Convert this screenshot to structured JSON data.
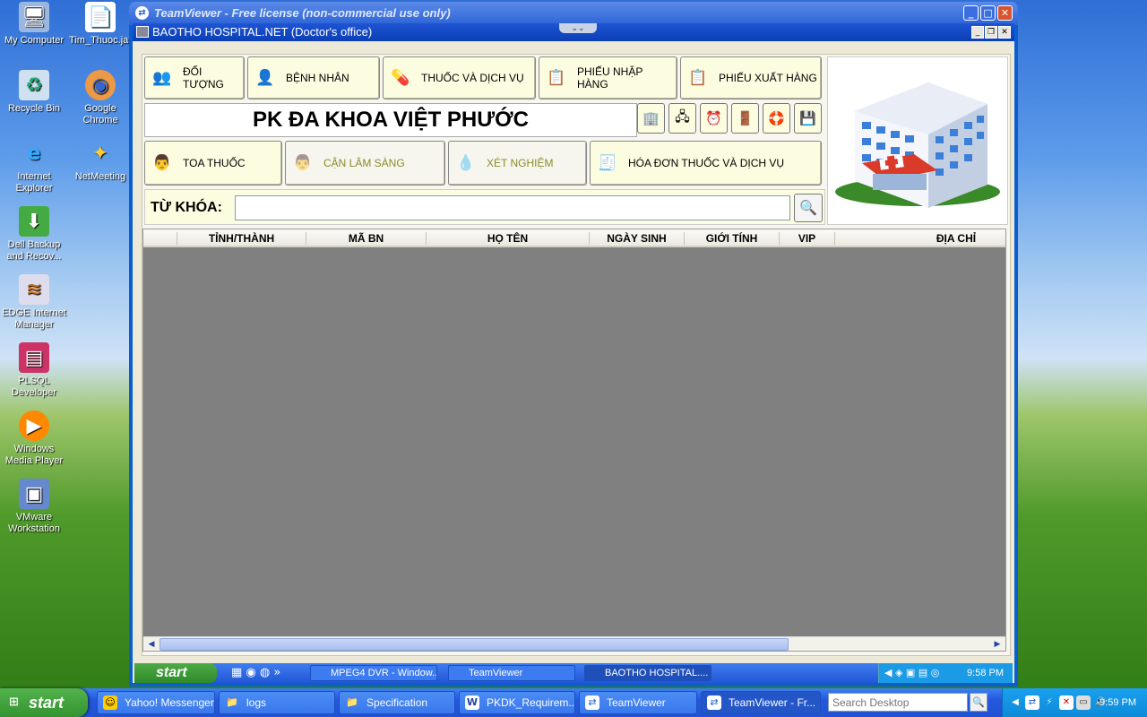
{
  "desktop": {
    "icons": [
      {
        "label": "My Computer",
        "name": "my-computer-icon",
        "glyph": "🖥"
      },
      {
        "label": "Tim_Thuoc.jar",
        "name": "jar-file-icon",
        "glyph": "📄"
      },
      {
        "label": "Recycle Bin",
        "name": "recycle-bin-icon",
        "glyph": "♻"
      },
      {
        "label": "Google Chrome",
        "name": "chrome-icon",
        "glyph": "◉"
      },
      {
        "label": "Internet Explorer",
        "name": "internet-explorer-icon",
        "glyph": "e"
      },
      {
        "label": "NetMeeting",
        "name": "netmeeting-icon",
        "glyph": "✦"
      },
      {
        "label": "Dell Backup and Recov...",
        "name": "dell-backup-icon",
        "glyph": "⬇"
      },
      {
        "label": "EDGE Internet Manager",
        "name": "edge-internet-manager-icon",
        "glyph": "≋"
      },
      {
        "label": "PLSQL Developer",
        "name": "plsql-developer-icon",
        "glyph": "▤"
      },
      {
        "label": "Windows Media Player",
        "name": "media-player-icon",
        "glyph": "▶"
      },
      {
        "label": "VMware Workstation",
        "name": "vmware-icon",
        "glyph": "▣"
      }
    ]
  },
  "teamviewer": {
    "title": "TeamViewer - Free license (non-commercial use only)",
    "icon": "⇄"
  },
  "inner_window": {
    "title": "BAOTHO HOSPITAL.NET (Doctor's office)",
    "grip": "⌄⌄"
  },
  "toolbar": {
    "top": [
      {
        "label": "ĐỐI TƯỢNG",
        "glyph": "👥",
        "name": "doi-tuong-button"
      },
      {
        "label": "BỆNH NHÂN",
        "glyph": "👤",
        "name": "benh-nhan-button"
      },
      {
        "label": "THUỐC VÀ DỊCH VỤ",
        "glyph": "💊",
        "name": "thuoc-dich-vu-button"
      },
      {
        "label": "PHIẾU NHẬP HÀNG",
        "glyph": "📋",
        "name": "phieu-nhap-hang-button"
      },
      {
        "label": "PHIẾU XUẤT HÀNG",
        "glyph": "📋",
        "name": "phieu-xuat-hang-button"
      }
    ],
    "bottom": [
      {
        "label": "TOA THUỐC",
        "glyph": "👨",
        "name": "toa-thuoc-button"
      },
      {
        "label": "CẬN LÂM SÀNG",
        "glyph": "👨",
        "name": "can-lam-sang-button"
      },
      {
        "label": "XÉT NGHIỆM",
        "glyph": "💧",
        "name": "xet-nghiem-button"
      },
      {
        "label": "HÓA ĐƠN THUỐC VÀ DỊCH VỤ",
        "glyph": "🧾",
        "name": "hoa-don-button"
      }
    ],
    "tools": [
      {
        "name": "hospital-tool-icon",
        "glyph": "🏢"
      },
      {
        "name": "network-tool-icon",
        "glyph": "🖧"
      },
      {
        "name": "clock-tool-icon",
        "glyph": "⏰"
      },
      {
        "name": "exit-tool-icon",
        "glyph": "🚪"
      },
      {
        "name": "help-lifebuoy-icon",
        "glyph": "🛟"
      },
      {
        "name": "save-disk-icon",
        "glyph": "💾"
      }
    ]
  },
  "clinic_name": "PK ĐA KHOA VIỆT PHƯỚC",
  "search": {
    "label": "TỪ KHÓA:",
    "value": "",
    "icon": "🔍"
  },
  "table": {
    "columns": [
      "TỈNH/THÀNH",
      "MÃ BN",
      "HỌ TÊN",
      "NGÀY SINH",
      "GIỚI TÍNH",
      "VIP",
      "ĐỊA CHỈ"
    ],
    "rows": []
  },
  "inner_taskbar": {
    "start": "start",
    "items": [
      "MPEG4 DVR - Window...",
      "TeamViewer",
      "BAOTHO HOSPITAL...."
    ],
    "time": "9:58 PM"
  },
  "taskbar": {
    "start": "start",
    "items": [
      {
        "label": "Yahoo! Messenger",
        "glyph": "☺"
      },
      {
        "label": "logs",
        "glyph": "📁"
      },
      {
        "label": "Specification",
        "glyph": "📁"
      },
      {
        "label": "PKDK_Requirem...",
        "glyph": "W"
      },
      {
        "label": "TeamViewer",
        "glyph": "⇄"
      },
      {
        "label": "TeamViewer - Fr...",
        "glyph": "⇄"
      }
    ],
    "search_placeholder": "Search Desktop",
    "time": "9:59 PM"
  }
}
